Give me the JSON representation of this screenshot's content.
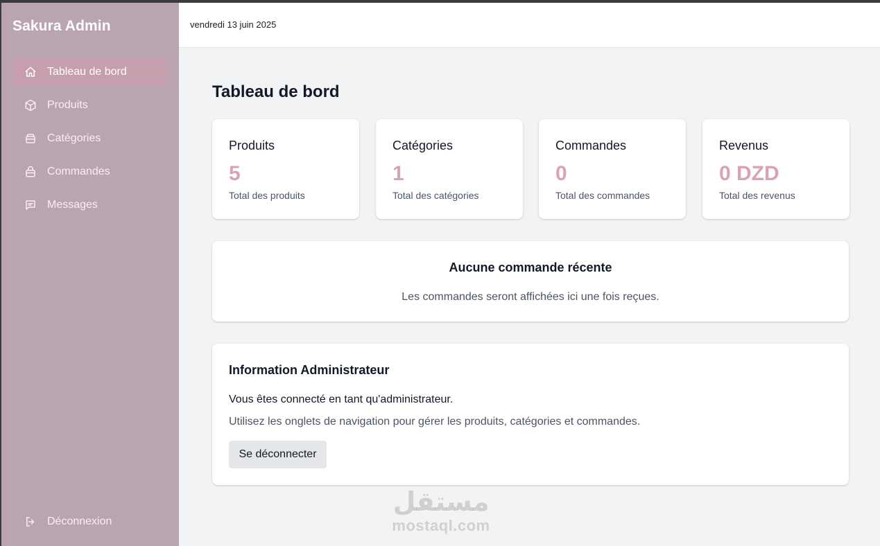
{
  "sidebar": {
    "brand": "Sakura Admin",
    "items": [
      {
        "label": "Tableau de bord",
        "icon": "home-icon",
        "active": true
      },
      {
        "label": "Produits",
        "icon": "box-icon",
        "active": false
      },
      {
        "label": "Catégories",
        "icon": "layers-icon",
        "active": false
      },
      {
        "label": "Commandes",
        "icon": "shopping-bag-icon",
        "active": false
      },
      {
        "label": "Messages",
        "icon": "message-icon",
        "active": false
      }
    ],
    "logout": {
      "label": "Déconnexion",
      "icon": "logout-icon"
    }
  },
  "header": {
    "date": "vendredi 13 juin 2025"
  },
  "main": {
    "title": "Tableau de bord",
    "stats": [
      {
        "label": "Produits",
        "value": "5",
        "sub": "Total des produits"
      },
      {
        "label": "Catégories",
        "value": "1",
        "sub": "Total des catégories"
      },
      {
        "label": "Commandes",
        "value": "0",
        "sub": "Total des commandes"
      },
      {
        "label": "Revenus",
        "value": "0 DZD",
        "sub": "Total des revenus"
      }
    ],
    "recent_orders": {
      "title": "Aucune commande récente",
      "message": "Les commandes seront affichées ici une fois reçues."
    },
    "admin_info": {
      "title": "Information Administrateur",
      "line1": "Vous êtes connecté en tant qu'administrateur.",
      "line2": "Utilisez les onglets de navigation pour gérer les produits, catégories et commandes.",
      "button": "Se déconnecter"
    }
  },
  "watermark": {
    "arabic": "مستقل",
    "latin": "mostaql.com"
  },
  "colors": {
    "sidebar": "#b9a4b0",
    "active_item": "#c79ead",
    "stat_value": "#d8a3b4",
    "background": "#f2f3f5"
  }
}
